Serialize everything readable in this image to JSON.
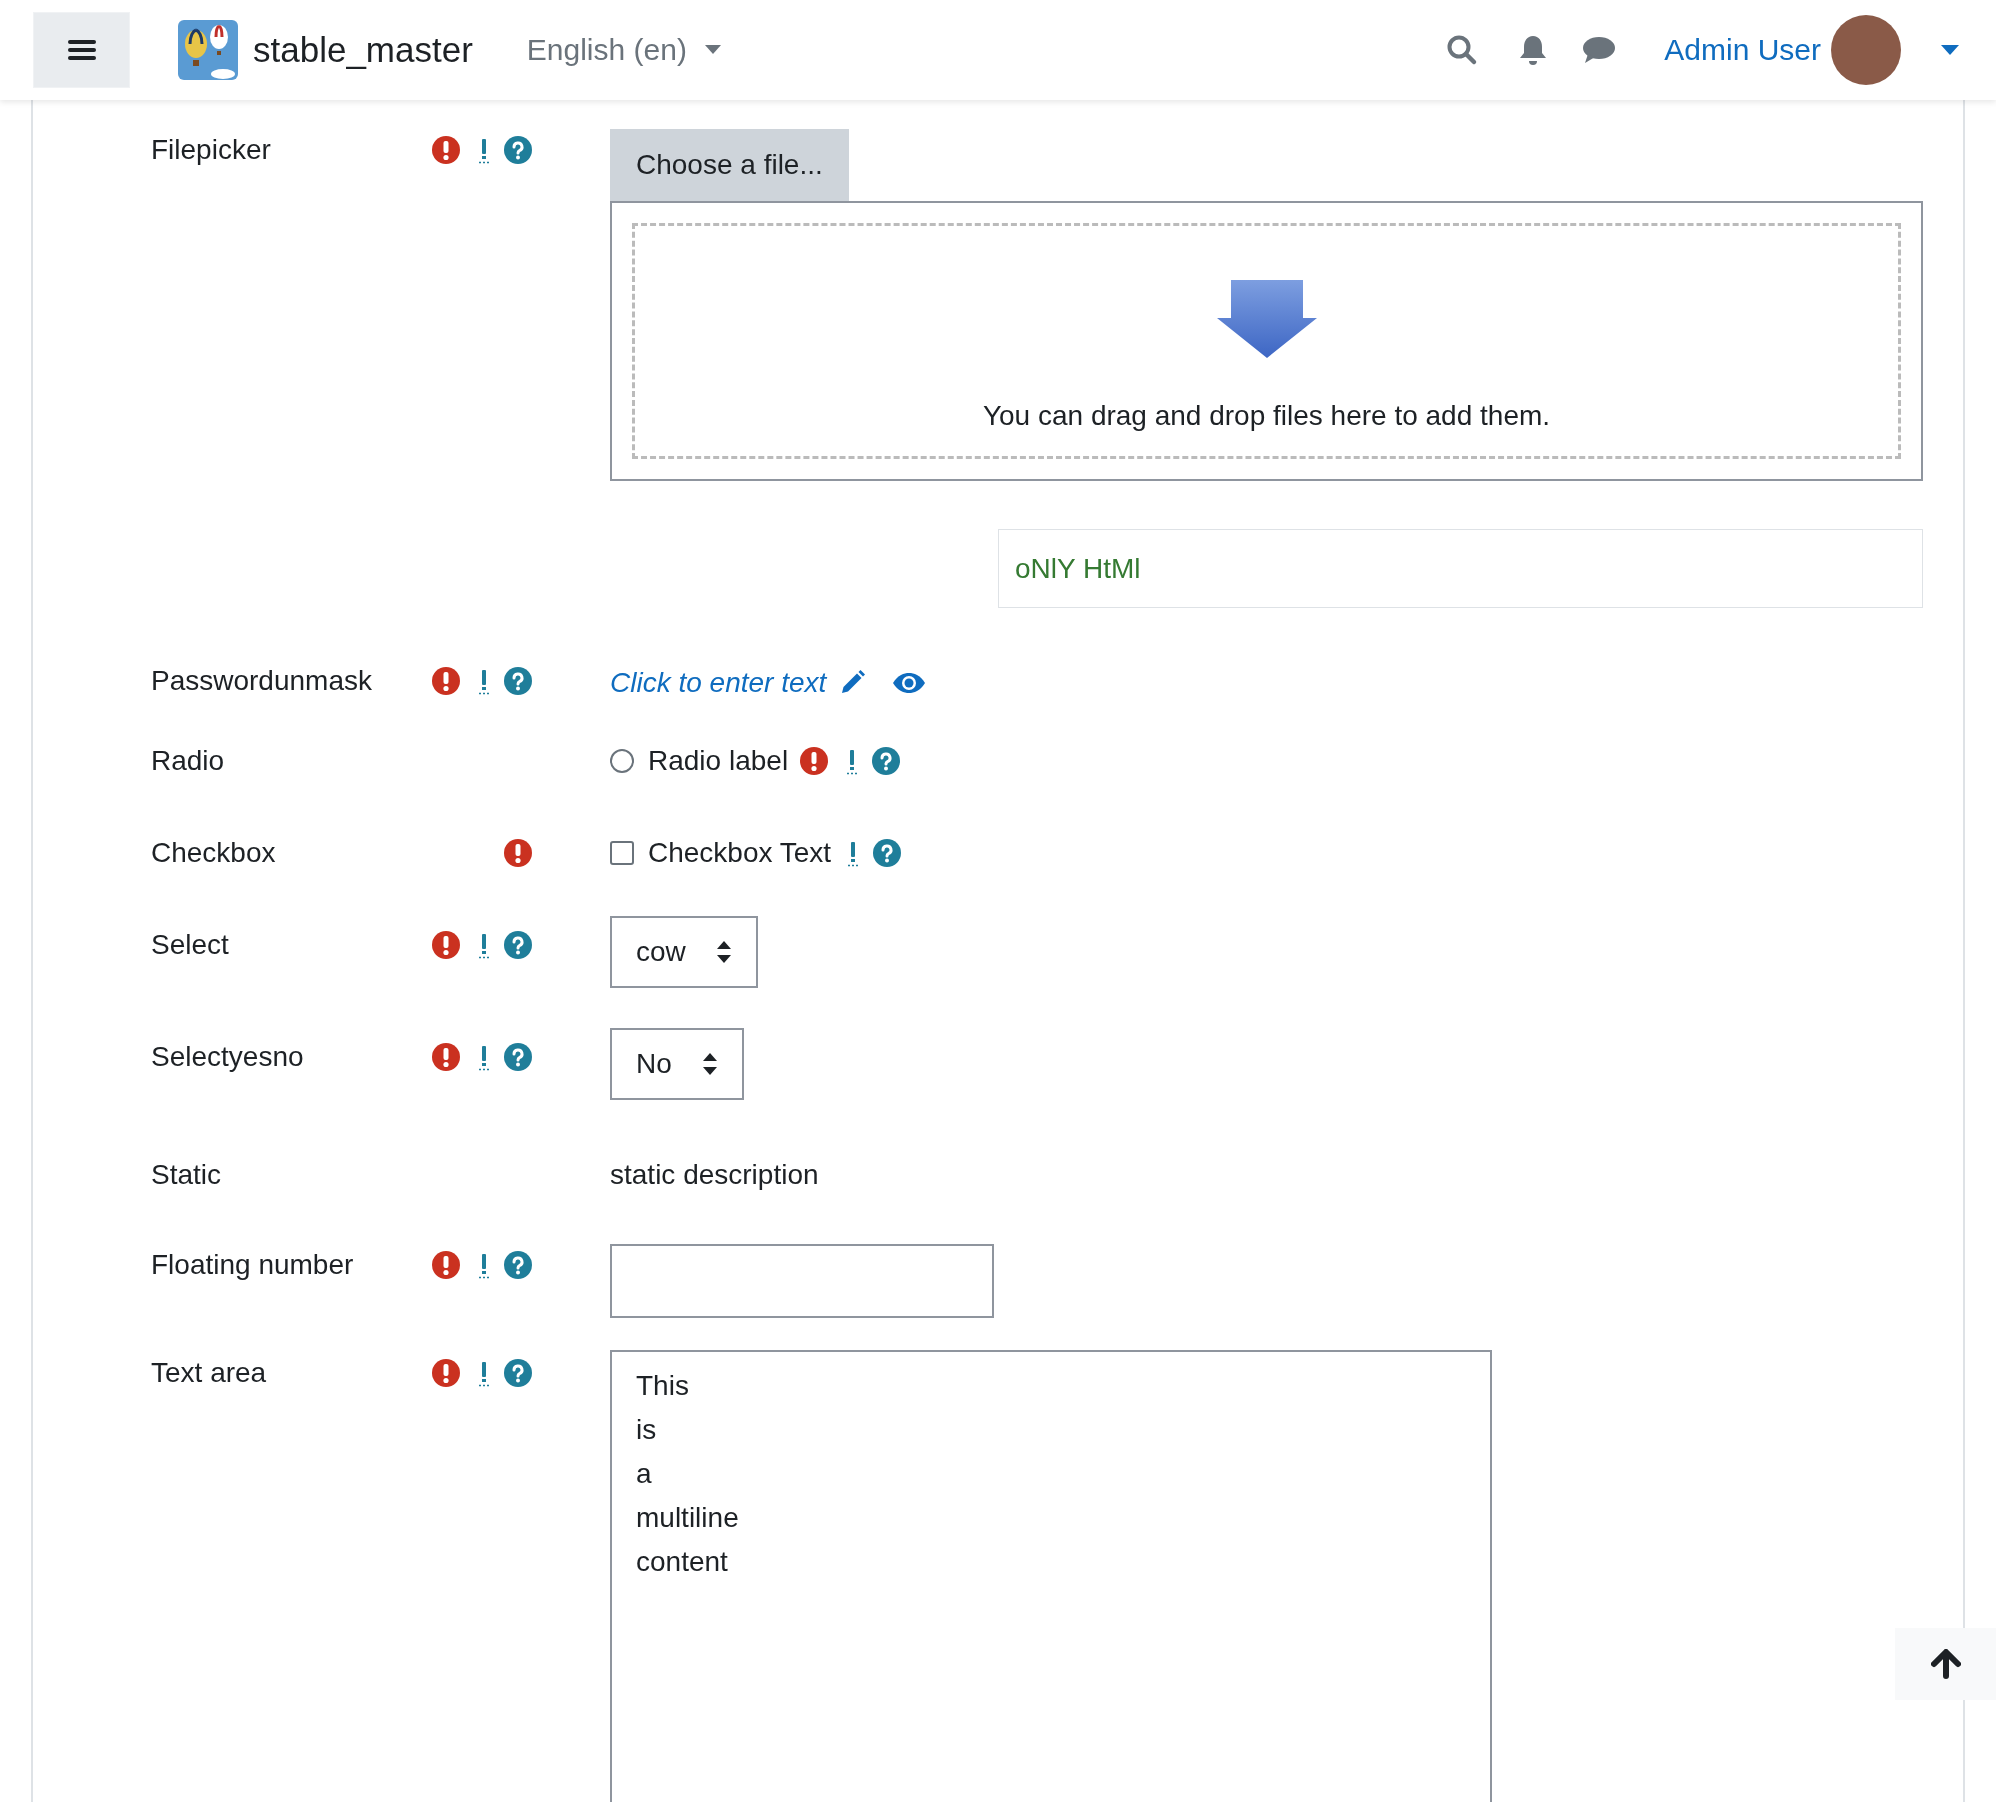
{
  "header": {
    "site_name": "stable_master",
    "language": "English (en)",
    "user_name": "Admin User"
  },
  "rows": [
    {
      "kind": "filepicker",
      "label": "Filepicker",
      "required": true,
      "advanced": true,
      "help": true,
      "button": "Choose a file...",
      "dropzone_text": "You can drag and drop files here to add them.",
      "note_value": "oNlY HtMl"
    },
    {
      "kind": "passwordunmask",
      "label": "Passwordunmask",
      "required": true,
      "advanced": true,
      "help": true,
      "link_text": "Click to enter text"
    },
    {
      "kind": "radio",
      "label": "Radio",
      "required": false,
      "advanced": false,
      "help": false,
      "option": "Radio label",
      "checked": false,
      "option_required": true,
      "option_advanced": true,
      "option_help": true
    },
    {
      "kind": "checkbox",
      "label": "Checkbox",
      "required": true,
      "advanced": false,
      "help": false,
      "option": "Checkbox Text",
      "checked": false,
      "option_required": false,
      "option_advanced": true,
      "option_help": true
    },
    {
      "kind": "select",
      "label": "Select",
      "required": true,
      "advanced": true,
      "help": true,
      "value": "cow"
    },
    {
      "kind": "select",
      "label": "Selectyesno",
      "required": true,
      "advanced": true,
      "help": true,
      "value": "No"
    },
    {
      "kind": "static",
      "label": "Static",
      "required": false,
      "advanced": false,
      "help": false,
      "value": "static description"
    },
    {
      "kind": "text",
      "label": "Floating number",
      "required": true,
      "advanced": true,
      "help": true
    },
    {
      "kind": "textarea",
      "label": "Text area",
      "required": true,
      "advanced": true,
      "help": true,
      "value": "This\nis\na\nmultiline\ncontent"
    }
  ]
}
